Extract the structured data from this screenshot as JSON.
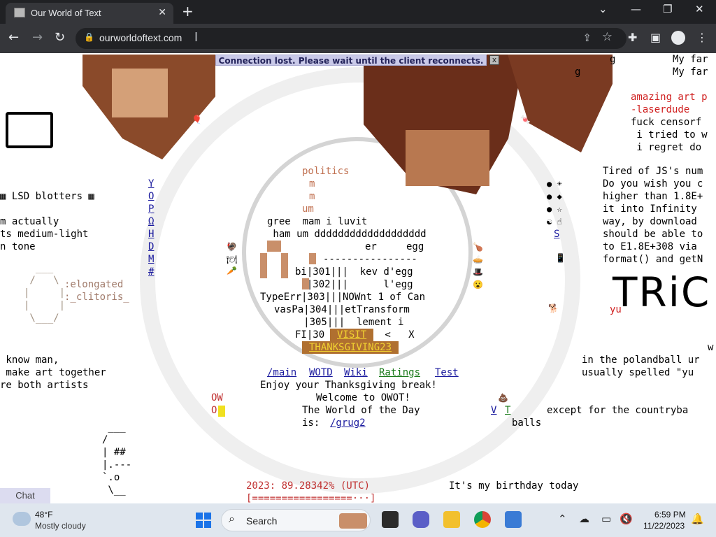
{
  "browser": {
    "tab_title": "Our World of Text",
    "tab_close": "✕",
    "new_tab": "+",
    "url": "ourworldoftext.com",
    "win_minimize": "⌄",
    "win_min": "—",
    "win_max": "❐",
    "win_close": "✕"
  },
  "banner": {
    "text": "Connection lost. Please wait until the client reconnects.",
    "close": "x"
  },
  "left": {
    "lsd": "▦ LSD blotters ▦",
    "l1": "m actually",
    "l2": "ts medium-light",
    "l3": "n tone",
    "clit1": ":elongated",
    "clit2": ":_clitoris_",
    "k1": " know man,",
    "k2": " make art together",
    "k3": "re both artists",
    "ascii": " ___\n/\n| ##\n|.---\n`.o\n \\__",
    "ow1": "OW",
    "ow2": "O",
    "vcol": [
      "Y",
      "O",
      "P",
      "Ω",
      "H",
      "D",
      "M",
      "#"
    ]
  },
  "center": {
    "politics": "politics",
    "m1": "m",
    "m2": "m",
    "um": "um",
    "gree": "gree  mam i luvit",
    "ham": " ham um ddddddddddddddddddd",
    "ereg": "er     egg",
    "dash": "----------------",
    "r1": "bi|301|||  kev d'egg",
    "r2": "  |302|||      l'egg",
    "r3": "TypeErr|303|||NOWnt 1 of Can",
    "r4": "vasPa|304|||etTransform",
    "r5": "     |305|||  lement i",
    "r6": "FI|30",
    "visit": "VISIT",
    "lt": " <   X",
    "thanks": "THANKSGIVING23"
  },
  "nav": {
    "links": [
      "/main",
      "WOTD",
      "Wiki",
      "Ratings",
      "Test"
    ],
    "enjoy": "Enjoy your Thanksgiving break!",
    "welcome": "Welcome to OWOT!",
    "wotd": "The World of the Day",
    "is": "is:",
    "grug": "/grug2"
  },
  "bottom": {
    "year": "2023: 89.28342% (UTC)",
    "bar": "[=================···]",
    "birthday": "It's my birthday today",
    "vt1": "V",
    "vt2": "T",
    "except": "except for the countryba",
    "balls": "balls",
    "chat": "Chat"
  },
  "right": {
    "g1": "g",
    "g2": "g",
    "myfar1": "My far",
    "myfar2": "My far",
    "amazing": "amazing art p",
    "laser": "-laserdude",
    "censor": "fuck censorf",
    "tried": " i tried to w",
    "regret": " i regret do",
    "js1": "Tired of JS's num",
    "js2": "Do you wish you c",
    "js3": "higher than 1.8E+",
    "js4": "it into Infinity",
    "js5": "way, by download",
    "js6": "should be able to",
    "js7": "to E1.8E+308 via",
    "js8": "format() and getN",
    "s": "S",
    "yu": "yu",
    "tric": "TRiC",
    "w": "w",
    "poland1": "in the polandball ur",
    "poland2": "usually spelled \"yu"
  },
  "taskbar": {
    "temp": "48°F",
    "cond": "Mostly cloudy",
    "search": "Search",
    "time": "6:59 PM",
    "date": "11/22/2023"
  }
}
